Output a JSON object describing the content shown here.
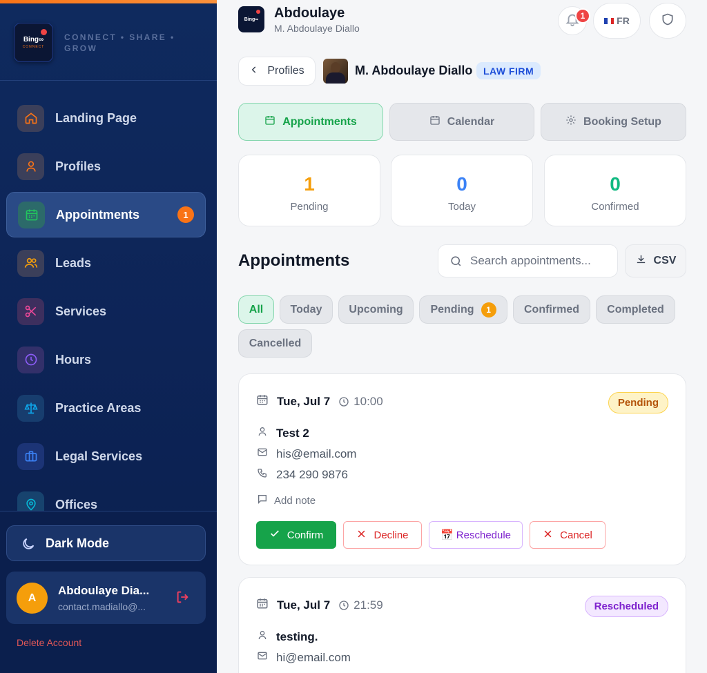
{
  "brand": {
    "tagline": "CONNECT • SHARE • GROW",
    "logo_text": "Bing∞",
    "logo_sub": "CONNECT"
  },
  "sidebar": {
    "items": [
      {
        "label": "Landing Page",
        "icon": "home-icon",
        "color": "#f97316"
      },
      {
        "label": "Profiles",
        "icon": "user-icon",
        "color": "#f97316"
      },
      {
        "label": "Appointments",
        "icon": "calendar-icon",
        "color": "#22c55e",
        "badge": "1",
        "active": true
      },
      {
        "label": "Leads",
        "icon": "users-icon",
        "color": "#f59e0b"
      },
      {
        "label": "Services",
        "icon": "scissors-icon",
        "color": "#ec4899"
      },
      {
        "label": "Hours",
        "icon": "clock-icon",
        "color": "#8b5cf6"
      },
      {
        "label": "Practice Areas",
        "icon": "scale-icon",
        "color": "#0ea5e9"
      },
      {
        "label": "Legal Services",
        "icon": "briefcase-icon",
        "color": "#3b82f6"
      },
      {
        "label": "Offices",
        "icon": "map-pin-icon",
        "color": "#06b6d4"
      }
    ],
    "dark_mode_label": "Dark Mode",
    "user": {
      "initial": "A",
      "name": "Abdoulaye Dia...",
      "email": "contact.madiallo@..."
    },
    "delete_account": "Delete Account"
  },
  "header": {
    "title": "Abdoulaye",
    "subtitle": "M. Abdoulaye Diallo",
    "notifications": "1",
    "language": "FR"
  },
  "profile_bar": {
    "back_label": "Profiles",
    "name": "M. Abdoulaye Diallo",
    "badge": "LAW FIRM"
  },
  "tabs": [
    {
      "label": "Appointments",
      "active": true
    },
    {
      "label": "Calendar"
    },
    {
      "label": "Booking Setup"
    }
  ],
  "stats": [
    {
      "value": "1",
      "label": "Pending",
      "color": "#f59e0b"
    },
    {
      "value": "0",
      "label": "Today",
      "color": "#3b82f6"
    },
    {
      "value": "0",
      "label": "Confirmed",
      "color": "#10b981"
    }
  ],
  "list": {
    "title": "Appointments",
    "search_placeholder": "Search appointments...",
    "csv_label": "CSV",
    "filters": [
      {
        "label": "All",
        "active": true
      },
      {
        "label": "Today"
      },
      {
        "label": "Upcoming"
      },
      {
        "label": "Pending",
        "badge": "1"
      },
      {
        "label": "Confirmed"
      },
      {
        "label": "Completed"
      },
      {
        "label": "Cancelled"
      }
    ]
  },
  "appointments": [
    {
      "date": "Tue, Jul 7",
      "time": "10:00",
      "status": "Pending",
      "name": "Test 2",
      "email": "his@email.com",
      "phone": "234 290 9876",
      "add_note": "Add note",
      "actions": {
        "confirm": "Confirm",
        "decline": "Decline",
        "reschedule": "📅 Reschedule",
        "cancel": "Cancel"
      }
    },
    {
      "date": "Tue, Jul 7",
      "time": "21:59",
      "status": "Rescheduled",
      "name": "testing.",
      "email": "hi@email.com"
    }
  ]
}
